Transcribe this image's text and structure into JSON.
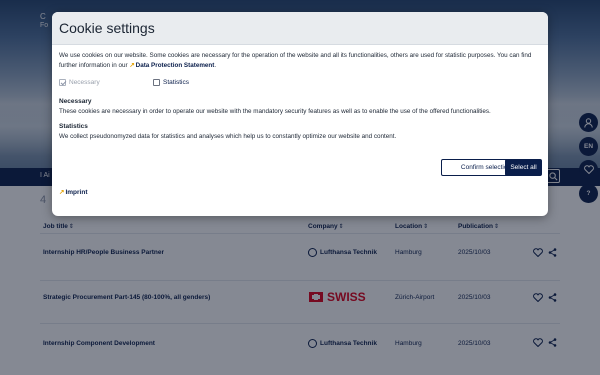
{
  "background": {
    "hero": {
      "title": "C",
      "subtitle": "Fo"
    },
    "filter_text": "I Ai",
    "results_count": "4",
    "columns": [
      {
        "label": "Job title",
        "sort_icon": "sort-icon"
      },
      {
        "label": "Company",
        "sort_icon": "sort-icon"
      },
      {
        "label": "Location",
        "sort_icon": "sort-icon"
      },
      {
        "label": "Publication",
        "sort_icon": "sort-icon"
      }
    ],
    "jobs": [
      {
        "title": "Internship HR/People Business Partner",
        "company": "Lufthansa Technik",
        "location": "Hamburg",
        "publication": "2025/10/03"
      },
      {
        "title": "Strategic Procurement Part-145 (80-100%, all genders)",
        "company": "SWISS",
        "location": "Zürich-Airport",
        "publication": "2025/10/03"
      },
      {
        "title": "Internship Component Development",
        "company": "Lufthansa Technik",
        "location": "Hamburg",
        "publication": "2025/10/03"
      }
    ],
    "side_buttons": {
      "language": "EN",
      "help": "?"
    }
  },
  "modal": {
    "title": "Cookie settings",
    "intro_text": "We use cookies on our website. Some cookies are necessary for the operation of the website and all its functionalities, others are used for statistic purposes. You can find further information in our",
    "data_protection_link": "Data Protection Statement",
    "intro_end": ".",
    "checkboxes": [
      {
        "label": "Necessary",
        "checked": true,
        "disabled": true
      },
      {
        "label": "Statistics",
        "checked": false,
        "disabled": false
      }
    ],
    "sections": [
      {
        "title": "Necessary",
        "text": "These cookies are necessary in order to operate our website with the mandatory security features as well as to enable the use of the offered functionalities."
      },
      {
        "title": "Statistics",
        "text": "We collect pseudonomyzed data for statistics and analyses which help us to constantly optimize our website and content."
      }
    ],
    "confirm_button": "Confirm selection",
    "select_all_button": "Select all",
    "imprint_link": "Imprint"
  },
  "colors": {
    "brand_navy": "#0a1e4b",
    "link_arrow": "#e5a50a",
    "swiss_red": "#e1001a",
    "overlay": "#0c1428"
  }
}
